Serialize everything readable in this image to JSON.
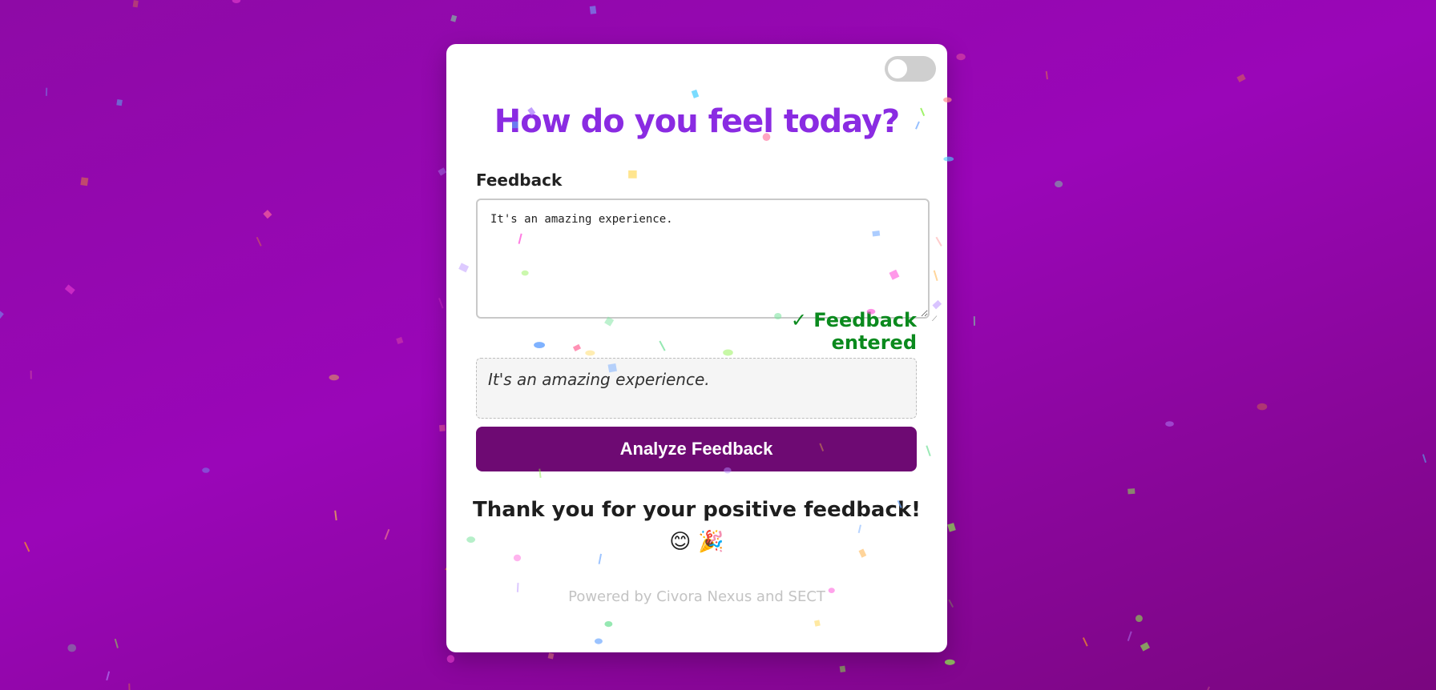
{
  "header": {
    "title": "How do you feel today?",
    "theme_toggle_on": false
  },
  "form": {
    "feedback_label": "Feedback",
    "feedback_value": "It's an amazing experience.",
    "entered_status": "✓ Feedback entered",
    "preview_text": "It's an amazing experience.",
    "analyze_label": "Analyze Feedback"
  },
  "result": {
    "message": "Thank you for your positive feedback! 😊 🎉"
  },
  "footer": {
    "powered_by": "Powered by Civora Nexus and SECT"
  },
  "colors": {
    "title": "#8a2be2",
    "button": "#6e0a73",
    "success": "#0b8a1e",
    "background": "#9a06b8"
  }
}
